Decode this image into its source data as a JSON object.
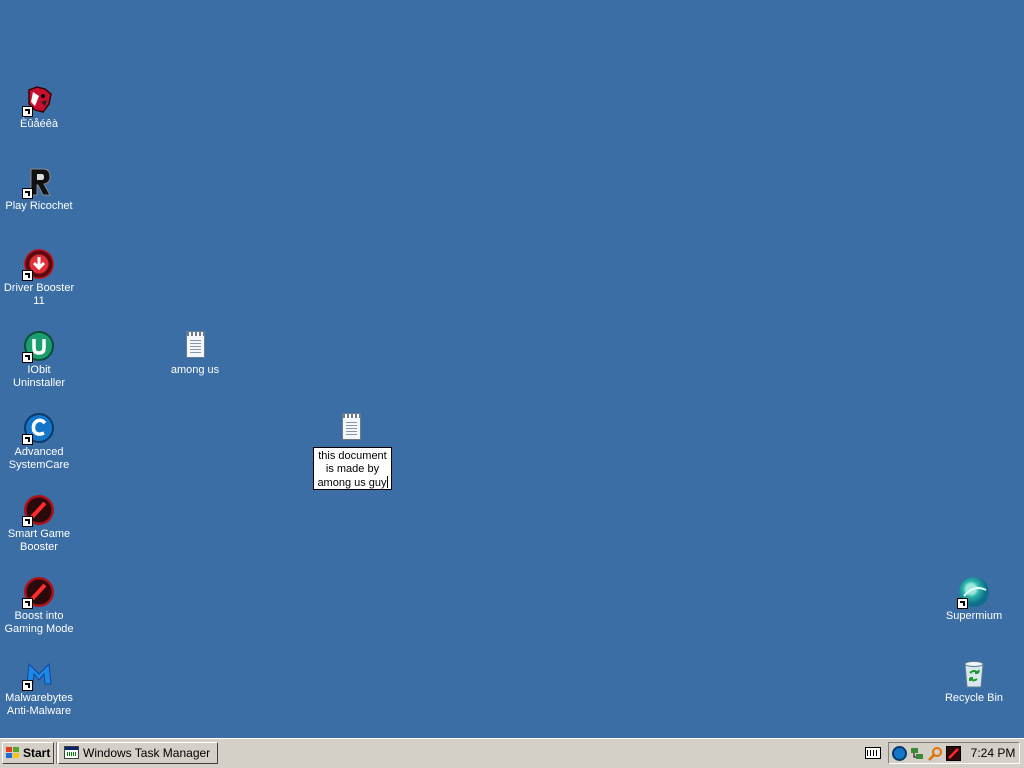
{
  "desktop": {
    "background_color": "#3a6ea5",
    "icons_left": [
      {
        "label": "Èûåéêà",
        "icon": "dog-head-icon"
      },
      {
        "label": "Play Ricochet",
        "icon": "ricochet-r-icon"
      },
      {
        "label": "Driver Booster 11",
        "icon": "driver-booster-icon"
      },
      {
        "label": "IObit Uninstaller",
        "icon": "iobit-uninstaller-icon"
      },
      {
        "label": "Advanced SystemCare",
        "icon": "advanced-systemcare-icon"
      },
      {
        "label": "Smart Game Booster",
        "icon": "smart-game-booster-icon"
      },
      {
        "label": "Boost into Gaming Mode",
        "icon": "gaming-mode-icon"
      },
      {
        "label": "Malwarebytes Anti-Malware",
        "icon": "malwarebytes-icon"
      }
    ],
    "text_file_icon": {
      "label": "among us",
      "icon": "text-document-icon"
    },
    "renaming_file": {
      "value": "this document is made by among us guy",
      "icon": "text-document-icon"
    },
    "icons_right": [
      {
        "label": "Supermium",
        "icon": "supermium-icon"
      },
      {
        "label": "Recycle Bin",
        "icon": "recycle-bin-icon"
      }
    ]
  },
  "taskbar": {
    "start_label": "Start",
    "tasks": [
      {
        "label": "Windows Task Manager",
        "icon": "task-manager-icon"
      }
    ],
    "tray_icons": [
      "keyboard-icon",
      "systemcare-tray-icon",
      "network-tray-icon",
      "search-tray-icon",
      "game-booster-tray-icon"
    ],
    "clock": "7:24 PM"
  }
}
